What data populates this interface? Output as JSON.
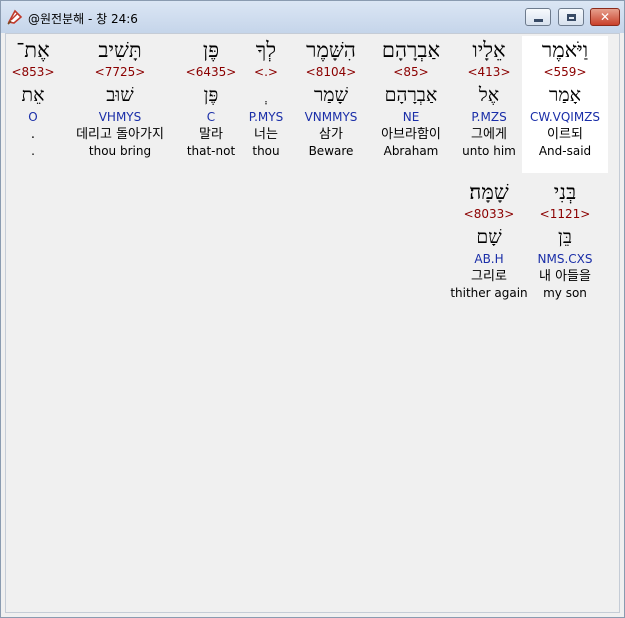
{
  "window": {
    "title": "@원전분해 - 창 24:6",
    "close_glyph": "✕",
    "colors": {
      "number": "#8b0000",
      "code": "#1a2ea8",
      "selected_bg": "#ffffff"
    }
  },
  "rows": [
    [
      {
        "hebrew": "וַיֹּאמֶר",
        "strong": "<559>",
        "root": "אָמַר",
        "parse": "CW.VQIMZS",
        "korean": "이르되",
        "english": "And-said",
        "selected": true
      },
      {
        "hebrew": "אֵלָיו",
        "strong": "<413>",
        "root": "אֶל",
        "parse": "P.MZS",
        "korean": "그에게",
        "english": "unto him"
      },
      {
        "hebrew": "אַבְרָהָם",
        "strong": "<85>",
        "root": "אַבְרָהָם",
        "parse": "NE",
        "korean": "아브라함이",
        "english": "Abraham"
      },
      {
        "hebrew": "הִשָּׁמֶר",
        "strong": "<8104>",
        "root": "שָׁמַר",
        "parse": "VNMMYS",
        "korean": "삼가",
        "english": "Beware"
      },
      {
        "hebrew": "לְךָ",
        "strong": "<.>",
        "root": "ְ",
        "parse": "P.MYS",
        "korean": "너는",
        "english": "thou"
      },
      {
        "hebrew": "פֶּן",
        "strong": "<6435>",
        "root": "פֶּן",
        "parse": "C",
        "korean": "말라",
        "english": "that-not"
      },
      {
        "hebrew": "תָּשִׁיב",
        "strong": "<7725>",
        "root": "שׁוּב",
        "parse": "VHMYS",
        "korean": "데리고 돌아가지",
        "english": "thou bring"
      },
      {
        "hebrew": "אֶת־",
        "strong": "<853>",
        "root": "אֵת",
        "parse": "O",
        "korean": ".",
        "english": "."
      }
    ],
    [
      {
        "hebrew": "בְּנִי",
        "strong": "<1121>",
        "root": "בֵּן",
        "parse": "NMS.CXS",
        "korean": "내 아들을",
        "english": "my son"
      },
      {
        "hebrew": "שָׁמָּה׃",
        "strong": "<8033>",
        "root": "שָׁם",
        "parse": "AB.H",
        "korean": "그리로",
        "english": "thither again"
      }
    ]
  ]
}
